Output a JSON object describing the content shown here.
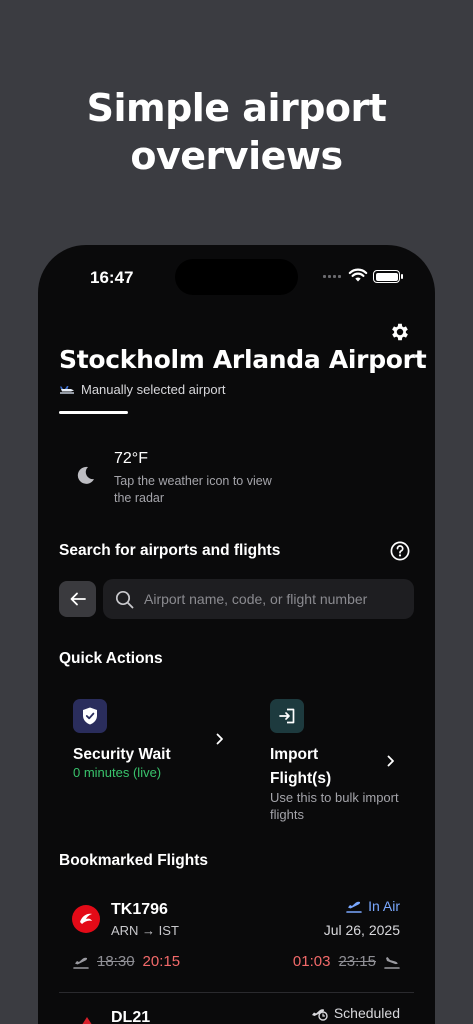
{
  "promo": {
    "line1": "Simple airport",
    "line2": "overviews"
  },
  "status_bar": {
    "time": "16:47"
  },
  "header": {
    "title": "Stockholm Arlanda Airport",
    "subtitle": "Manually selected airport",
    "plane_icon": "airplane-icon",
    "settings_icon": "gear-icon"
  },
  "weather": {
    "icon": "moon-icon",
    "temperature": "72°F",
    "hint": "Tap the weather icon to view the radar"
  },
  "search": {
    "header": "Search for airports and flights",
    "placeholder": "Airport name, code, or flight number",
    "value": ""
  },
  "quick_actions": {
    "header": "Quick Actions",
    "security": {
      "title": "Security Wait",
      "status": "0 minutes (live)"
    },
    "import": {
      "title_line1": "Import",
      "title_line2": "Flight(s)",
      "description": "Use this to bulk import flights"
    }
  },
  "bookmarks": {
    "header": "Bookmarked Flights",
    "flights": [
      {
        "number": "TK1796",
        "route": "ARN → IST",
        "status": "In Air",
        "date": "Jul 26, 2025",
        "dep_scheduled": "18:30",
        "dep_actual": "20:15",
        "arr_actual": "01:03",
        "arr_scheduled": "23:15"
      },
      {
        "number": "DL21",
        "status": "Scheduled"
      }
    ]
  },
  "colors": {
    "background": "#3b3c41",
    "screen": "#0a0a0b",
    "status_live": "#39c36c",
    "status_in_air": "#7aa8ff",
    "delayed_time": "#f26a6a"
  }
}
